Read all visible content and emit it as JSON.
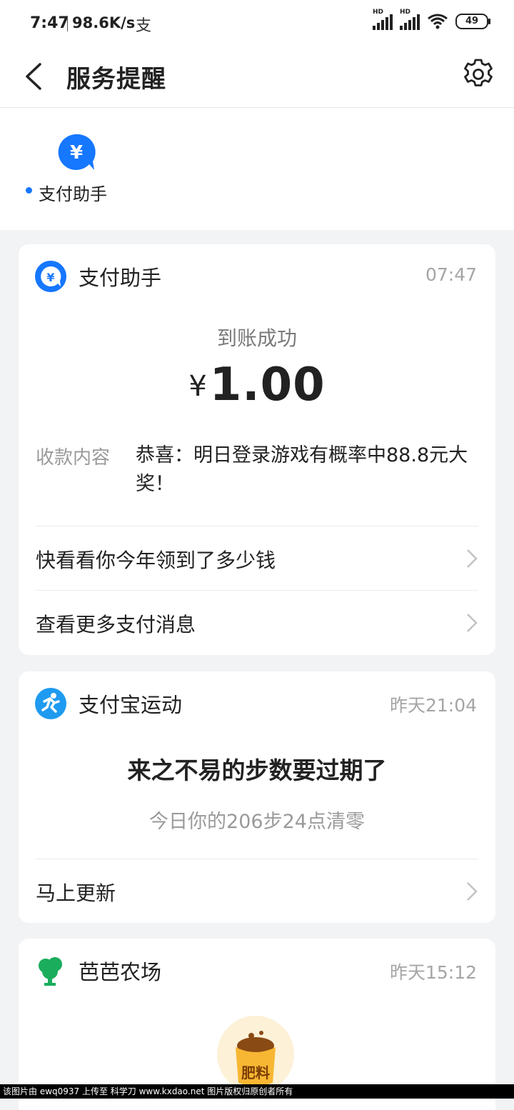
{
  "status_bar": {
    "time": "7:47",
    "network_speed": "98.6K/s",
    "app_icon": "支",
    "battery": "49",
    "signal_label": "HD"
  },
  "header": {
    "title": "服务提醒",
    "back_icon": "chevron-left-icon",
    "settings_icon": "gear-icon"
  },
  "tabs": [
    {
      "label": "支付助手",
      "icon": "yuan-chat-icon",
      "unread": true,
      "color": "#1677ff"
    }
  ],
  "cards": [
    {
      "source": "支付助手",
      "time": "07:47",
      "status": "到账成功",
      "currency": "¥",
      "amount": "1.00",
      "content_label": "收款内容",
      "content_text": "恭喜：明日登录游戏有概率中88.8元大奖！",
      "actions": [
        "快看看你今年领到了多少钱",
        "查看更多支付消息"
      ]
    },
    {
      "source": "支付宝运动",
      "time": "昨天21:04",
      "title": "来之不易的步数要过期了",
      "subtitle": "今日你的206步24点清零",
      "actions": [
        "马上更新"
      ]
    },
    {
      "source": "芭芭农场",
      "time": "昨天15:12",
      "image_label": "肥料"
    }
  ],
  "watermark": "该图片由 ewq0937 上传至 科学刀 www.kxdao.net 图片版权归原创者所有"
}
